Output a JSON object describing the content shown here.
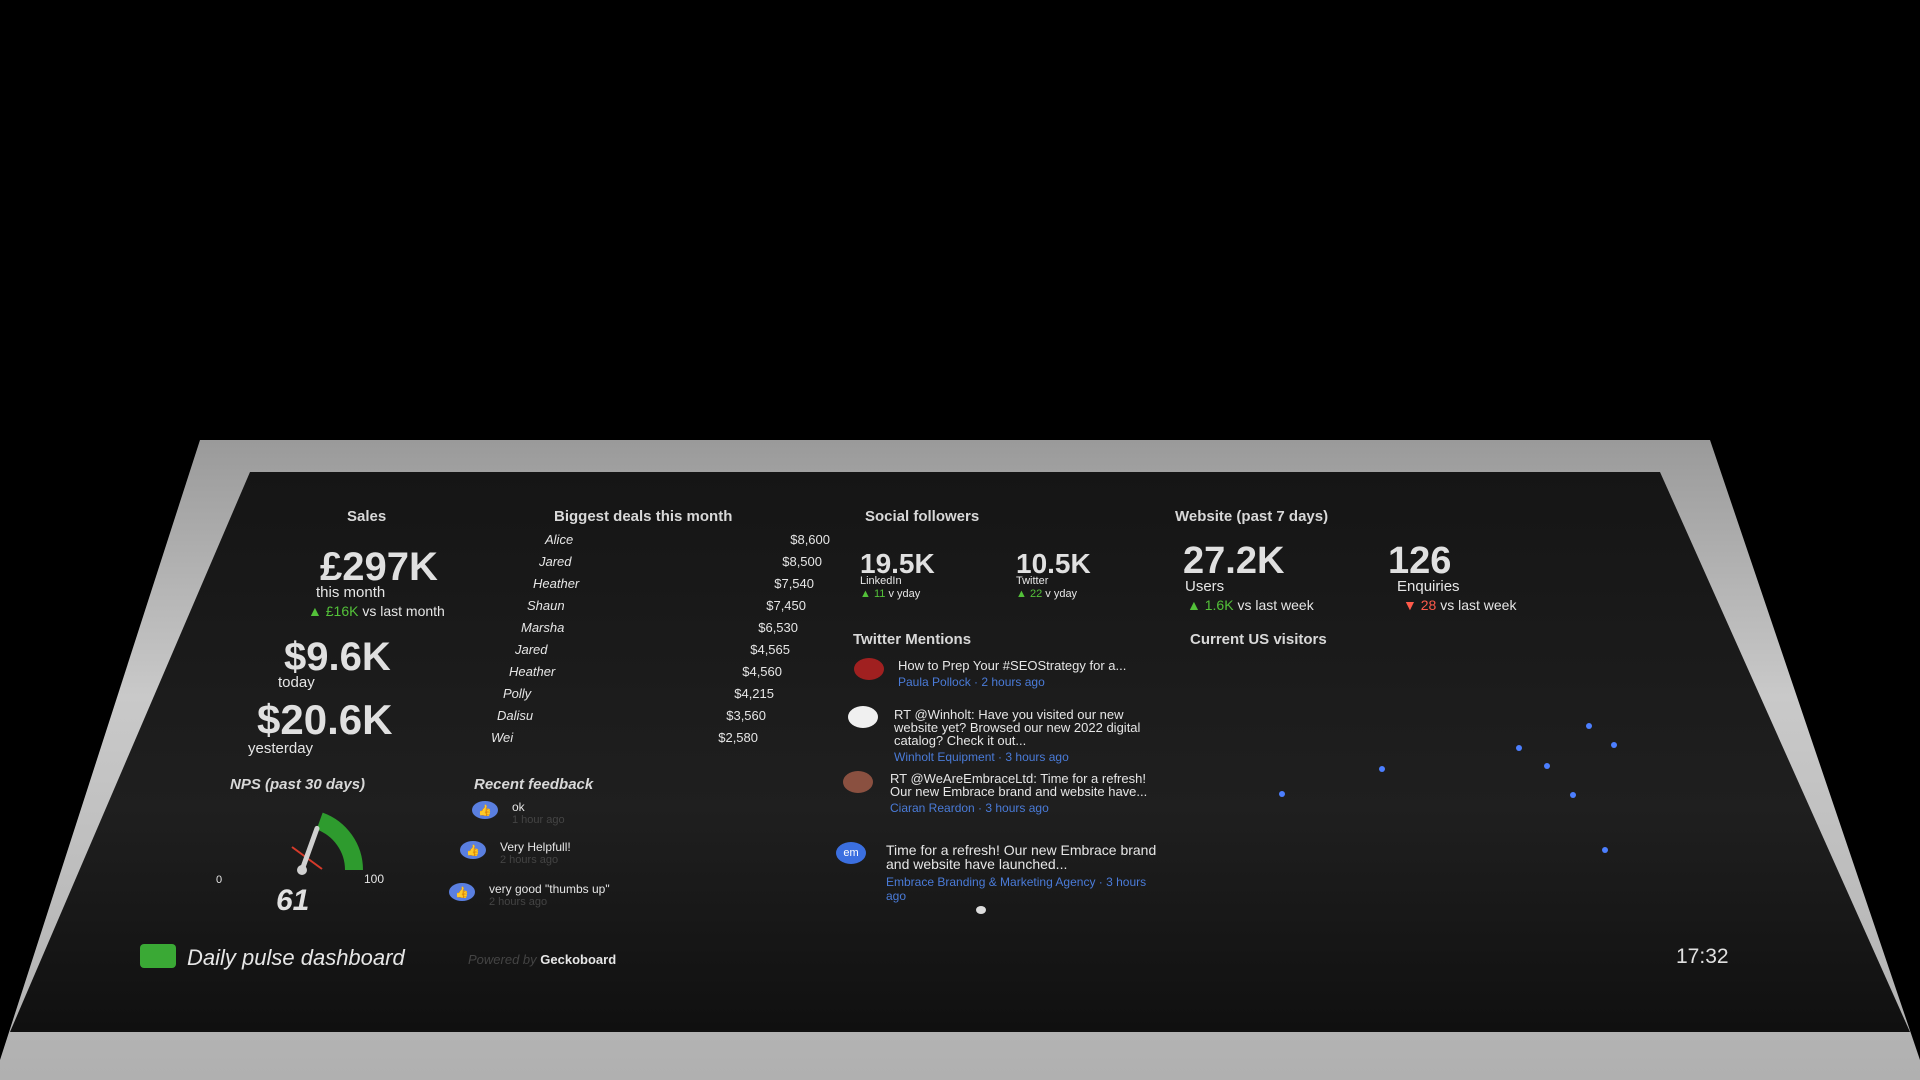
{
  "sales": {
    "title": "Sales",
    "month_value": "£297K",
    "month_label": "this month",
    "month_delta": "£16K",
    "month_delta_label": "vs last month",
    "today_value": "$9.6K",
    "today_label": "today",
    "yesterday_value": "$20.6K",
    "yesterday_label": "yesterday"
  },
  "deals": {
    "title": "Biggest deals this month",
    "rows": [
      {
        "name": "Alice",
        "value": "$8,600"
      },
      {
        "name": "Jared",
        "value": "$8,500"
      },
      {
        "name": "Heather",
        "value": "$7,540"
      },
      {
        "name": "Shaun",
        "value": "$7,450"
      },
      {
        "name": "Marsha",
        "value": "$6,530"
      },
      {
        "name": "Jared",
        "value": "$4,565"
      },
      {
        "name": "Heather",
        "value": "$4,560"
      },
      {
        "name": "Polly",
        "value": "$4,215"
      },
      {
        "name": "Dalisu",
        "value": "$3,560"
      },
      {
        "name": "Wei",
        "value": "$2,580"
      }
    ]
  },
  "social": {
    "title": "Social followers",
    "linkedin_value": "19.5K",
    "linkedin_label": "LinkedIn",
    "linkedin_delta": "11",
    "linkedin_delta_label": "v yday",
    "twitter_value": "10.5K",
    "twitter_label": "Twitter",
    "twitter_delta": "22",
    "twitter_delta_label": "v yday"
  },
  "website": {
    "title": "Website (past 7 days)",
    "users_value": "27.2K",
    "users_label": "Users",
    "users_delta": "1.6K",
    "users_delta_label": "vs last week",
    "enquiries_value": "126",
    "enquiries_label": "Enquiries",
    "enquiries_delta": "28",
    "enquiries_delta_label": "vs last week"
  },
  "mentions": {
    "title": "Twitter Mentions",
    "items": [
      {
        "text": "How to Prep Your #SEOStrategy for a...",
        "meta": "Paula Pollock · 2 hours ago"
      },
      {
        "text": "RT @Winholt: Have you visited our new website yet? Browsed our new 2022 digital catalog? Check it out...",
        "meta": "Winholt Equipment · 3 hours ago"
      },
      {
        "text": "RT @WeAreEmbraceLtd: Time for a refresh! Our new Embrace brand and website have...",
        "meta": "Ciaran Reardon · 3 hours ago"
      },
      {
        "text": "Time for a refresh! Our new Embrace brand and website have launched...",
        "meta": "Embrace Branding & Marketing Agency · 3 hours ago"
      }
    ]
  },
  "visitors": {
    "title": "Current US visitors",
    "color": "#4c7fff"
  },
  "nps": {
    "title": "NPS (past 30 days)",
    "min": "0",
    "max": "100",
    "value": "61",
    "score": 61,
    "color": "#2e9b2e"
  },
  "feedback": {
    "title": "Recent feedback",
    "items": [
      {
        "text": "ok",
        "time": "1 hour ago"
      },
      {
        "text": "Very Helpfull!",
        "time": "2 hours ago"
      },
      {
        "text": "very good \"thumbs up\"",
        "time": "2 hours ago"
      }
    ]
  },
  "footer": {
    "title": "Daily pulse dashboard",
    "powered": "Powered by",
    "brand": "Geckoboard",
    "clock": "17:32"
  }
}
